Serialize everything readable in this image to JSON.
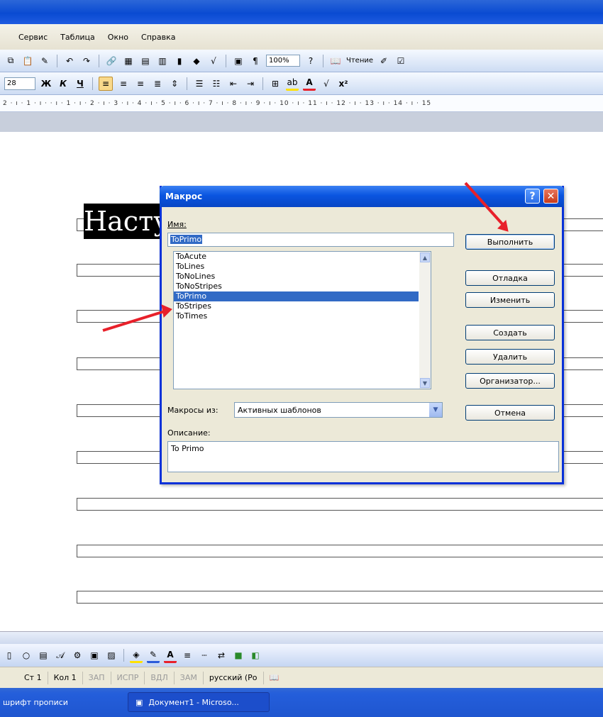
{
  "menu": {
    "items": [
      "Сервис",
      "Таблица",
      "Окно",
      "Справка"
    ]
  },
  "toolbar1": {
    "zoom": "100%",
    "read_label": "Чтение"
  },
  "toolbar2": {
    "font_size": "28",
    "bold": "Ж",
    "italic": "К",
    "underline": "Ч"
  },
  "ruler": {
    "text": "2 · ı · 1 · ı ·   · ı · 1 · ı · 2 · ı · 3 · ı · 4 · ı · 5 · ı · 6 · ı · 7 · ı · 8 · ı · 9 · ı · 10 · ı · 11 · ı · 12 · ı · 13 · ı · 14 · ı · 15"
  },
  "document": {
    "heading": "Насту"
  },
  "dialog": {
    "title": "Макрос",
    "help": "?",
    "close": "✕",
    "name_label": "Имя:",
    "name_value": "ToPrimo",
    "macros": [
      "ToAcute",
      "ToLines",
      "ToNoLines",
      "ToNoStripes",
      "ToPrimo",
      "ToStripes",
      "ToTimes"
    ],
    "selected_index": 4,
    "buttons": {
      "run": "Выполнить",
      "debug": "Отладка",
      "edit": "Изменить",
      "create": "Создать",
      "delete": "Удалить",
      "organizer": "Организатор...",
      "cancel": "Отмена"
    },
    "macros_from_label": "Макросы из:",
    "macros_from_value": "Активных шаблонов",
    "description_label": "Описание:",
    "description_value": "To Primo"
  },
  "statusbar": {
    "page": "Ст 1",
    "col": "Кол 1",
    "rec": "ЗАП",
    "trk": "ИСПР",
    "ext": "ВДЛ",
    "ovr": "ЗАМ",
    "lang": "русский (Ро"
  },
  "taskbar": {
    "left_item": "шрифт прописи",
    "task": "Документ1 - Microso..."
  },
  "colors": {
    "accent_arrow": "#e8202a",
    "selection": "#316ac5"
  }
}
